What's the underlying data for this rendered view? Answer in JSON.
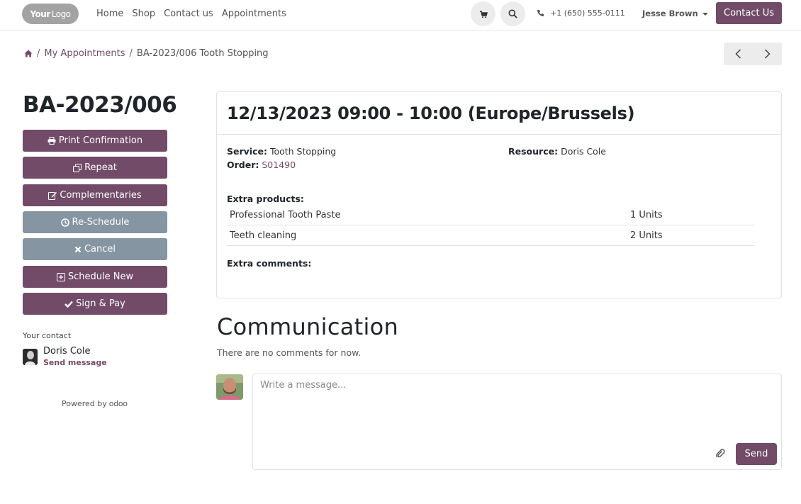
{
  "navbar": {
    "logo_bold": "Your",
    "logo_thin": "Logo",
    "links": [
      "Home",
      "Shop",
      "Contact us",
      "Appointments"
    ],
    "phone": "+1 (650) 555-0111",
    "user": "Jesse Brown",
    "contact_button": "Contact Us",
    "icons": {
      "cart": "cart-icon",
      "search": "search-icon",
      "phone": "phone-icon"
    }
  },
  "breadcrumb": {
    "parent": "My Appointments",
    "current": "BA-2023/006 Tooth Stopping"
  },
  "sidebar": {
    "title": "BA-2023/006",
    "buttons": [
      {
        "label": "Print Confirmation",
        "icon": "print-icon",
        "style": "primary"
      },
      {
        "label": "Repeat",
        "icon": "copy-icon",
        "style": "primary"
      },
      {
        "label": "Complementaries",
        "icon": "edit-icon",
        "style": "primary"
      },
      {
        "label": "Re-Schedule",
        "icon": "clock-icon",
        "style": "secondary"
      },
      {
        "label": "Cancel",
        "icon": "close-icon",
        "style": "secondary"
      },
      {
        "label": "Schedule New",
        "icon": "plus-square-icon",
        "style": "primary"
      },
      {
        "label": "Sign & Pay",
        "icon": "check-icon",
        "style": "primary"
      }
    ],
    "your_contact_label": "Your contact",
    "contact_name": "Doris Cole",
    "send_message": "Send message",
    "powered_by": "Powered by",
    "powered_brand": "odoo"
  },
  "appointment": {
    "datetime": "12/13/2023 09:00 - 10:00 (Europe/Brussels)",
    "service_label": "Service:",
    "service_value": "Tooth Stopping",
    "order_label": "Order:",
    "order_value": "S01490",
    "resource_label": "Resource:",
    "resource_value": "Doris Cole",
    "extra_products_label": "Extra products:",
    "extra_products": [
      {
        "name": "Professional Tooth Paste",
        "qty": "1 Units"
      },
      {
        "name": "Teeth cleaning",
        "qty": "2 Units"
      }
    ],
    "extra_comments_label": "Extra comments:"
  },
  "communication": {
    "title": "Communication",
    "empty_text": "There are no comments for now.",
    "placeholder": "Write a message...",
    "send_label": "Send"
  },
  "colors": {
    "primary": "#714b67",
    "secondary": "#8595a2"
  }
}
